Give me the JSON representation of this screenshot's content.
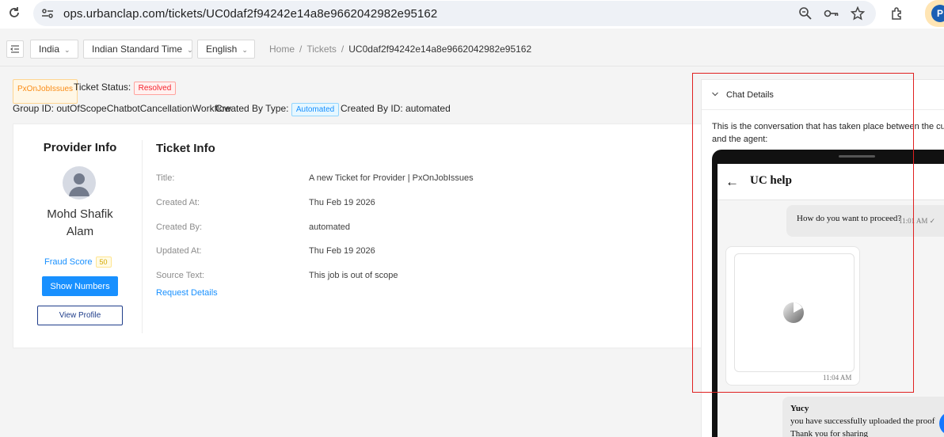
{
  "browser": {
    "url": "ops.urbanclap.com/tickets/UC0daf2f94242e14a8e9662042982e95162",
    "profile_initial": "P"
  },
  "topnav": {
    "country": "India",
    "timezone": "Indian Standard Time",
    "language": "English",
    "breadcrumb": [
      "Home",
      "Tickets",
      "UC0daf2f94242e14a8e9662042982e95162"
    ]
  },
  "ticket_header": {
    "category_tag": "PxOnJobIssues",
    "status_label": "Ticket Status:",
    "status_value": "Resolved",
    "group_id": "Group ID: outOfScopeChatbotCancellationWorkflow",
    "created_by_type_label": "Created By Type:",
    "created_by_type_value": "Automated",
    "created_by_id": "Created By ID: automated"
  },
  "provider": {
    "title": "Provider Info",
    "name_line1": "Mohd Shafik",
    "name_line2": "Alam",
    "fraud_label": "Fraud Score",
    "fraud_score": "50",
    "show_numbers": "Show Numbers",
    "view_profile": "View Profile"
  },
  "ticket_info": {
    "title": "Ticket Info",
    "rows": [
      {
        "label": "Title:",
        "value": "A new Ticket for Provider | PxOnJobIssues"
      },
      {
        "label": "Created At:",
        "value": "Thu Feb 19 2026"
      },
      {
        "label": "Created By:",
        "value": "automated"
      },
      {
        "label": "Updated At:",
        "value": "Thu Feb 19 2026"
      },
      {
        "label": "Source Text:",
        "value": "This job is out of scope"
      }
    ],
    "request_details": "Request Details"
  },
  "chat": {
    "panel_title": "Chat Details",
    "description_line1": "This is the conversation that has taken place between the cu",
    "description_line2": "and the agent:",
    "app_title": "UC help",
    "messages": [
      {
        "text": "How do you want to proceed?",
        "time": "11:01 AM"
      },
      {
        "time": "11:04 AM"
      },
      {
        "sender": "Yucy",
        "text": "you have successfully uploaded the proof",
        "text2": "Thank you for sharing"
      }
    ]
  },
  "colors": {
    "primary": "#1890ff",
    "highlight": "#e02020"
  }
}
